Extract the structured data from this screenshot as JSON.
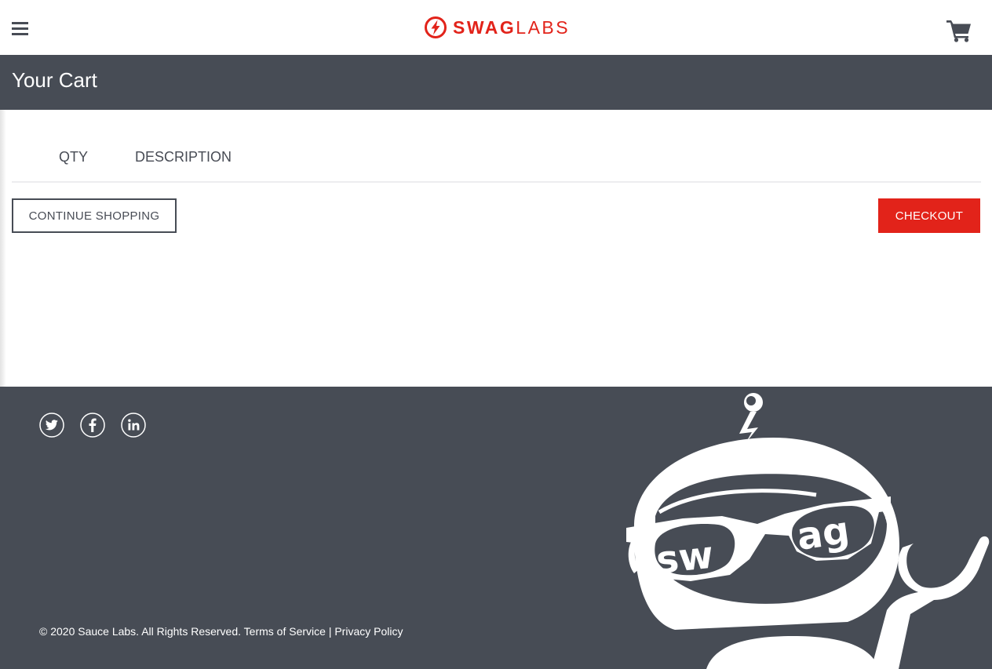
{
  "header": {
    "menu_icon": "hamburger-menu-icon",
    "logo_bold": "SWAG",
    "logo_light": "LABS",
    "cart_icon": "shopping-cart-icon"
  },
  "subheader": {
    "title": "Your Cart"
  },
  "cart": {
    "columns": [
      "QTY",
      "DESCRIPTION"
    ],
    "items": []
  },
  "actions": {
    "continue_label": "CONTINUE SHOPPING",
    "checkout_label": "CHECKOUT"
  },
  "footer": {
    "social_icons": [
      "twitter-icon",
      "facebook-icon",
      "linkedin-icon"
    ],
    "copyright": "© 2020 Sauce Labs. All Rights Reserved.",
    "terms": "Terms of Service",
    "separator": "|",
    "privacy": "Privacy Policy",
    "robot_word_left": "sw",
    "robot_word_right": "ag"
  },
  "colors": {
    "brand_red": "#e2231a",
    "dark_slate": "#474c55",
    "text": "#484c55",
    "white": "#ffffff"
  }
}
